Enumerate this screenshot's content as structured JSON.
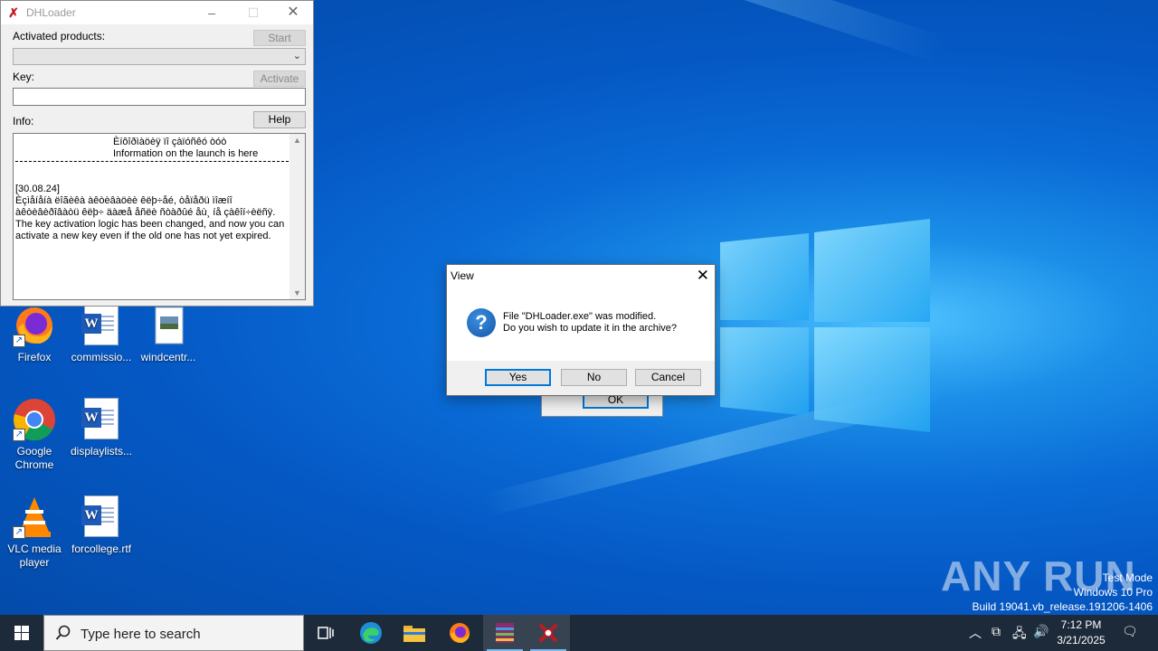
{
  "dhloader": {
    "title": "DHLoader",
    "activated_label": "Activated products:",
    "start_label": "Start",
    "key_label": "Key:",
    "activate_label": "Activate",
    "info_label": "Info:",
    "help_label": "Help",
    "key_value": "",
    "info_header_1": "Èíôîðìàöèÿ ïî çàïóñêó òóò",
    "info_header_2": "Information on the launch is here",
    "info_date": "[30.08.24]",
    "info_line_1": "Èçìåíåíà ëîãèêà àêòèâàöèè êëþ÷åé, òåïåðü ìîæíî",
    "info_line_2": "àêòèâèðîâàòü êëþ÷ äàæå åñëè ñòàðûé åù¸ íå çàêîí÷èëñÿ.",
    "info_line_3": "The key activation logic has been changed, and now you can",
    "info_line_4": "activate a new key even if the old one has not yet expired."
  },
  "desktop_icons": [
    {
      "label": "Firefox"
    },
    {
      "label": "commissio..."
    },
    {
      "label": "windcentr..."
    },
    {
      "label": "Google Chrome"
    },
    {
      "label": "displaylists..."
    },
    {
      "label": "VLC media player"
    },
    {
      "label": "forcollege.rtf"
    }
  ],
  "bg_dialog": {
    "ok_label": "OK"
  },
  "view_dialog": {
    "title": "View",
    "message_1": "File \"DHLoader.exe\" was modified.",
    "message_2": "Do you wish to update it in the archive?",
    "yes_label": "Yes",
    "no_label": "No",
    "cancel_label": "Cancel"
  },
  "watermark": {
    "brand": "ANY RUN",
    "mode": "Test Mode",
    "edition": "Windows 10 Pro",
    "build": "Build 19041.vb_release.191206-1406"
  },
  "taskbar": {
    "search_placeholder": "Type here to search",
    "time": "7:12 PM",
    "date": "3/21/2025"
  },
  "colors": {
    "accent": "#0078d7",
    "taskbar": "#1d2a3a",
    "desktop": "#0a6bd6"
  }
}
